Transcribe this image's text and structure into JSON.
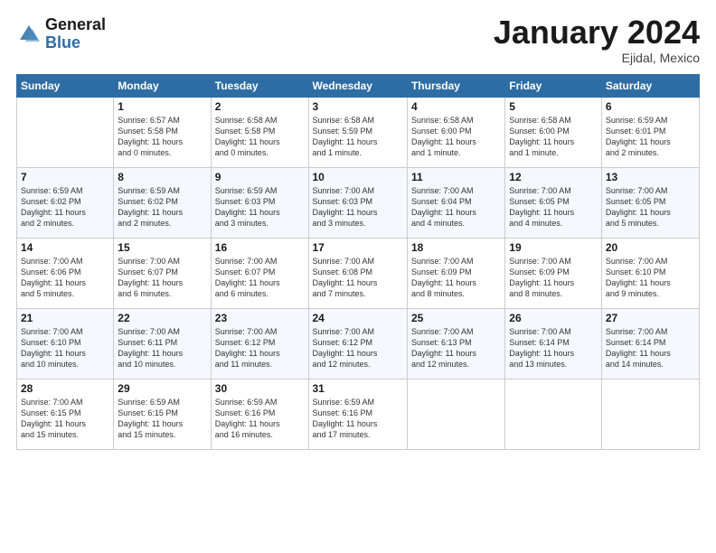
{
  "header": {
    "logo_line1": "General",
    "logo_line2": "Blue",
    "month_title": "January 2024",
    "subtitle": "Ejidal, Mexico"
  },
  "days_of_week": [
    "Sunday",
    "Monday",
    "Tuesday",
    "Wednesday",
    "Thursday",
    "Friday",
    "Saturday"
  ],
  "weeks": [
    [
      {
        "day": "",
        "info": ""
      },
      {
        "day": "1",
        "info": "Sunrise: 6:57 AM\nSunset: 5:58 PM\nDaylight: 11 hours\nand 0 minutes."
      },
      {
        "day": "2",
        "info": "Sunrise: 6:58 AM\nSunset: 5:58 PM\nDaylight: 11 hours\nand 0 minutes."
      },
      {
        "day": "3",
        "info": "Sunrise: 6:58 AM\nSunset: 5:59 PM\nDaylight: 11 hours\nand 1 minute."
      },
      {
        "day": "4",
        "info": "Sunrise: 6:58 AM\nSunset: 6:00 PM\nDaylight: 11 hours\nand 1 minute."
      },
      {
        "day": "5",
        "info": "Sunrise: 6:58 AM\nSunset: 6:00 PM\nDaylight: 11 hours\nand 1 minute."
      },
      {
        "day": "6",
        "info": "Sunrise: 6:59 AM\nSunset: 6:01 PM\nDaylight: 11 hours\nand 2 minutes."
      }
    ],
    [
      {
        "day": "7",
        "info": "Sunrise: 6:59 AM\nSunset: 6:02 PM\nDaylight: 11 hours\nand 2 minutes."
      },
      {
        "day": "8",
        "info": "Sunrise: 6:59 AM\nSunset: 6:02 PM\nDaylight: 11 hours\nand 2 minutes."
      },
      {
        "day": "9",
        "info": "Sunrise: 6:59 AM\nSunset: 6:03 PM\nDaylight: 11 hours\nand 3 minutes."
      },
      {
        "day": "10",
        "info": "Sunrise: 7:00 AM\nSunset: 6:03 PM\nDaylight: 11 hours\nand 3 minutes."
      },
      {
        "day": "11",
        "info": "Sunrise: 7:00 AM\nSunset: 6:04 PM\nDaylight: 11 hours\nand 4 minutes."
      },
      {
        "day": "12",
        "info": "Sunrise: 7:00 AM\nSunset: 6:05 PM\nDaylight: 11 hours\nand 4 minutes."
      },
      {
        "day": "13",
        "info": "Sunrise: 7:00 AM\nSunset: 6:05 PM\nDaylight: 11 hours\nand 5 minutes."
      }
    ],
    [
      {
        "day": "14",
        "info": "Sunrise: 7:00 AM\nSunset: 6:06 PM\nDaylight: 11 hours\nand 5 minutes."
      },
      {
        "day": "15",
        "info": "Sunrise: 7:00 AM\nSunset: 6:07 PM\nDaylight: 11 hours\nand 6 minutes."
      },
      {
        "day": "16",
        "info": "Sunrise: 7:00 AM\nSunset: 6:07 PM\nDaylight: 11 hours\nand 6 minutes."
      },
      {
        "day": "17",
        "info": "Sunrise: 7:00 AM\nSunset: 6:08 PM\nDaylight: 11 hours\nand 7 minutes."
      },
      {
        "day": "18",
        "info": "Sunrise: 7:00 AM\nSunset: 6:09 PM\nDaylight: 11 hours\nand 8 minutes."
      },
      {
        "day": "19",
        "info": "Sunrise: 7:00 AM\nSunset: 6:09 PM\nDaylight: 11 hours\nand 8 minutes."
      },
      {
        "day": "20",
        "info": "Sunrise: 7:00 AM\nSunset: 6:10 PM\nDaylight: 11 hours\nand 9 minutes."
      }
    ],
    [
      {
        "day": "21",
        "info": "Sunrise: 7:00 AM\nSunset: 6:10 PM\nDaylight: 11 hours\nand 10 minutes."
      },
      {
        "day": "22",
        "info": "Sunrise: 7:00 AM\nSunset: 6:11 PM\nDaylight: 11 hours\nand 10 minutes."
      },
      {
        "day": "23",
        "info": "Sunrise: 7:00 AM\nSunset: 6:12 PM\nDaylight: 11 hours\nand 11 minutes."
      },
      {
        "day": "24",
        "info": "Sunrise: 7:00 AM\nSunset: 6:12 PM\nDaylight: 11 hours\nand 12 minutes."
      },
      {
        "day": "25",
        "info": "Sunrise: 7:00 AM\nSunset: 6:13 PM\nDaylight: 11 hours\nand 12 minutes."
      },
      {
        "day": "26",
        "info": "Sunrise: 7:00 AM\nSunset: 6:14 PM\nDaylight: 11 hours\nand 13 minutes."
      },
      {
        "day": "27",
        "info": "Sunrise: 7:00 AM\nSunset: 6:14 PM\nDaylight: 11 hours\nand 14 minutes."
      }
    ],
    [
      {
        "day": "28",
        "info": "Sunrise: 7:00 AM\nSunset: 6:15 PM\nDaylight: 11 hours\nand 15 minutes."
      },
      {
        "day": "29",
        "info": "Sunrise: 6:59 AM\nSunset: 6:15 PM\nDaylight: 11 hours\nand 15 minutes."
      },
      {
        "day": "30",
        "info": "Sunrise: 6:59 AM\nSunset: 6:16 PM\nDaylight: 11 hours\nand 16 minutes."
      },
      {
        "day": "31",
        "info": "Sunrise: 6:59 AM\nSunset: 6:16 PM\nDaylight: 11 hours\nand 17 minutes."
      },
      {
        "day": "",
        "info": ""
      },
      {
        "day": "",
        "info": ""
      },
      {
        "day": "",
        "info": ""
      }
    ]
  ]
}
